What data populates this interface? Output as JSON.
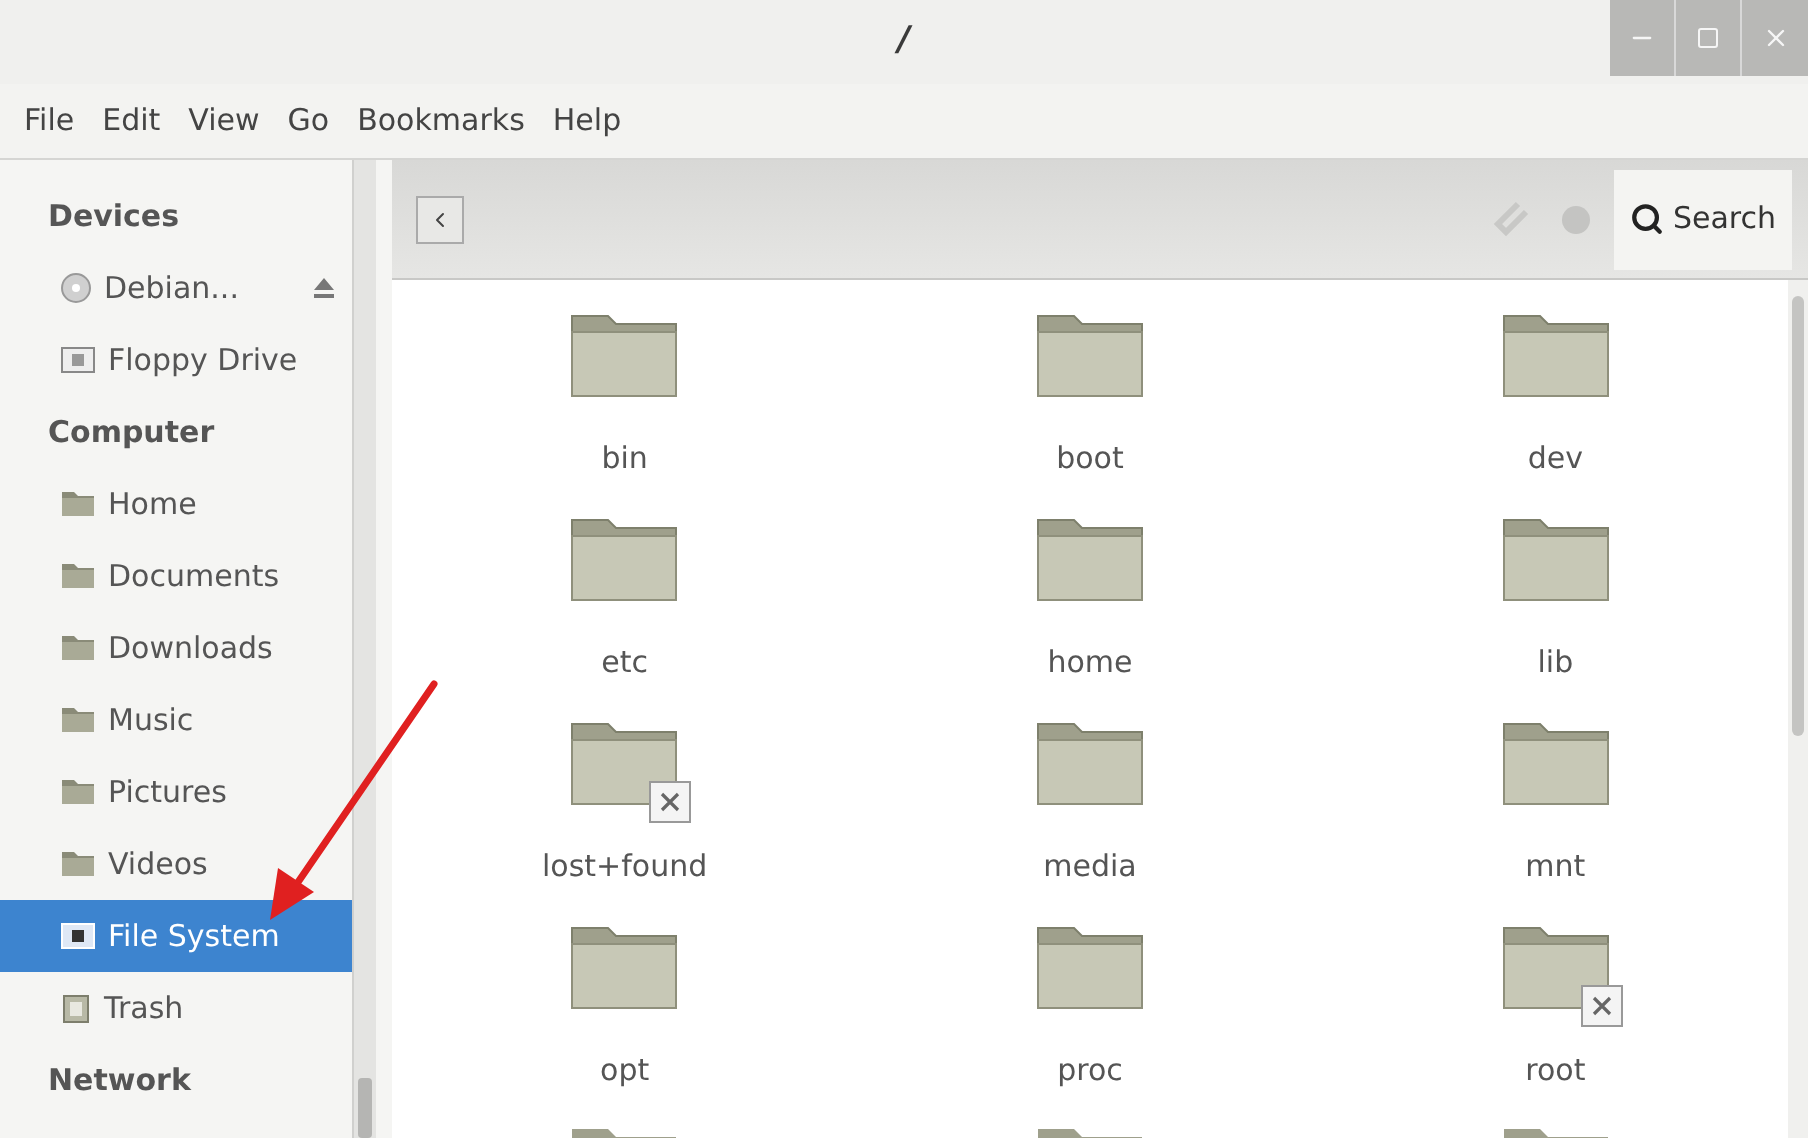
{
  "window": {
    "title": "/"
  },
  "menu": [
    "File",
    "Edit",
    "View",
    "Go",
    "Bookmarks",
    "Help"
  ],
  "sidebar": [
    {
      "heading": "Devices",
      "items": [
        {
          "label": "Debian...",
          "kind": "disc",
          "selected": false
        },
        {
          "label": "Floppy Drive",
          "kind": "drive",
          "selected": false
        }
      ]
    },
    {
      "heading": "Computer",
      "items": [
        {
          "label": "Home",
          "kind": "folder",
          "selected": false
        },
        {
          "label": "Documents",
          "kind": "folder",
          "selected": false
        },
        {
          "label": "Downloads",
          "kind": "folder",
          "selected": false
        },
        {
          "label": "Music",
          "kind": "folder",
          "selected": false
        },
        {
          "label": "Pictures",
          "kind": "folder",
          "selected": false
        },
        {
          "label": "Videos",
          "kind": "folder",
          "selected": false
        },
        {
          "label": "File System",
          "kind": "drive",
          "selected": true
        },
        {
          "label": "Trash",
          "kind": "trash",
          "selected": false
        }
      ]
    },
    {
      "heading": "Network"
    }
  ],
  "toolbar": {
    "search": "Search"
  },
  "files": [
    {
      "name": "bin",
      "locked": false
    },
    {
      "name": "boot",
      "locked": false
    },
    {
      "name": "dev",
      "locked": false
    },
    {
      "name": "etc",
      "locked": false
    },
    {
      "name": "home",
      "locked": false
    },
    {
      "name": "lib",
      "locked": false
    },
    {
      "name": "lost+found",
      "locked": true
    },
    {
      "name": "media",
      "locked": false
    },
    {
      "name": "mnt",
      "locked": false
    },
    {
      "name": "opt",
      "locked": false
    },
    {
      "name": "proc",
      "locked": false
    },
    {
      "name": "root",
      "locked": true
    },
    {
      "kind": "partial"
    },
    {
      "kind": "partial"
    },
    {
      "kind": "partial"
    }
  ],
  "annotation": {
    "kind": "arrow",
    "color": "#e02020"
  }
}
